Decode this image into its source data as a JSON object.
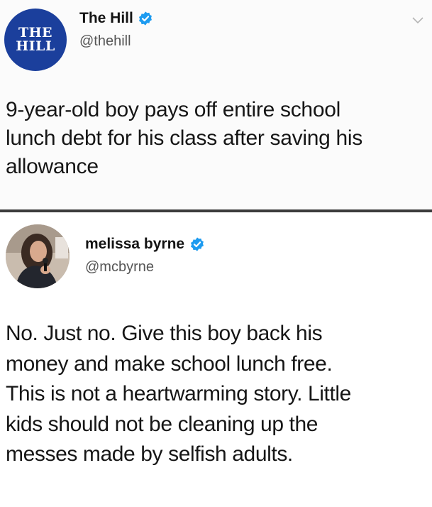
{
  "tweet1": {
    "avatar_logo_line1": "THE",
    "avatar_logo_line2": "HILL",
    "display_name": "The Hill",
    "handle": "@thehill",
    "text_lines": [
      "9-year-old boy pays off entire school",
      "lunch debt for his class after saving his",
      "allowance"
    ],
    "avatar_color": "#1b3f9c",
    "verified_icon": "verified-badge-icon",
    "menu_icon": "chevron-down-icon"
  },
  "tweet2": {
    "display_name": "melissa byrne",
    "handle": "@mcbyrne",
    "text_lines": [
      "No. Just no. Give this boy back his",
      "money and make school lunch free.",
      "This is not a heartwarming story. Little",
      "kids should not be cleaning up the",
      "messes made by selfish adults."
    ],
    "verified_icon": "verified-badge-icon"
  },
  "colors": {
    "verified_blue": "#1d9bf0",
    "separator": "#3c3c3c"
  }
}
